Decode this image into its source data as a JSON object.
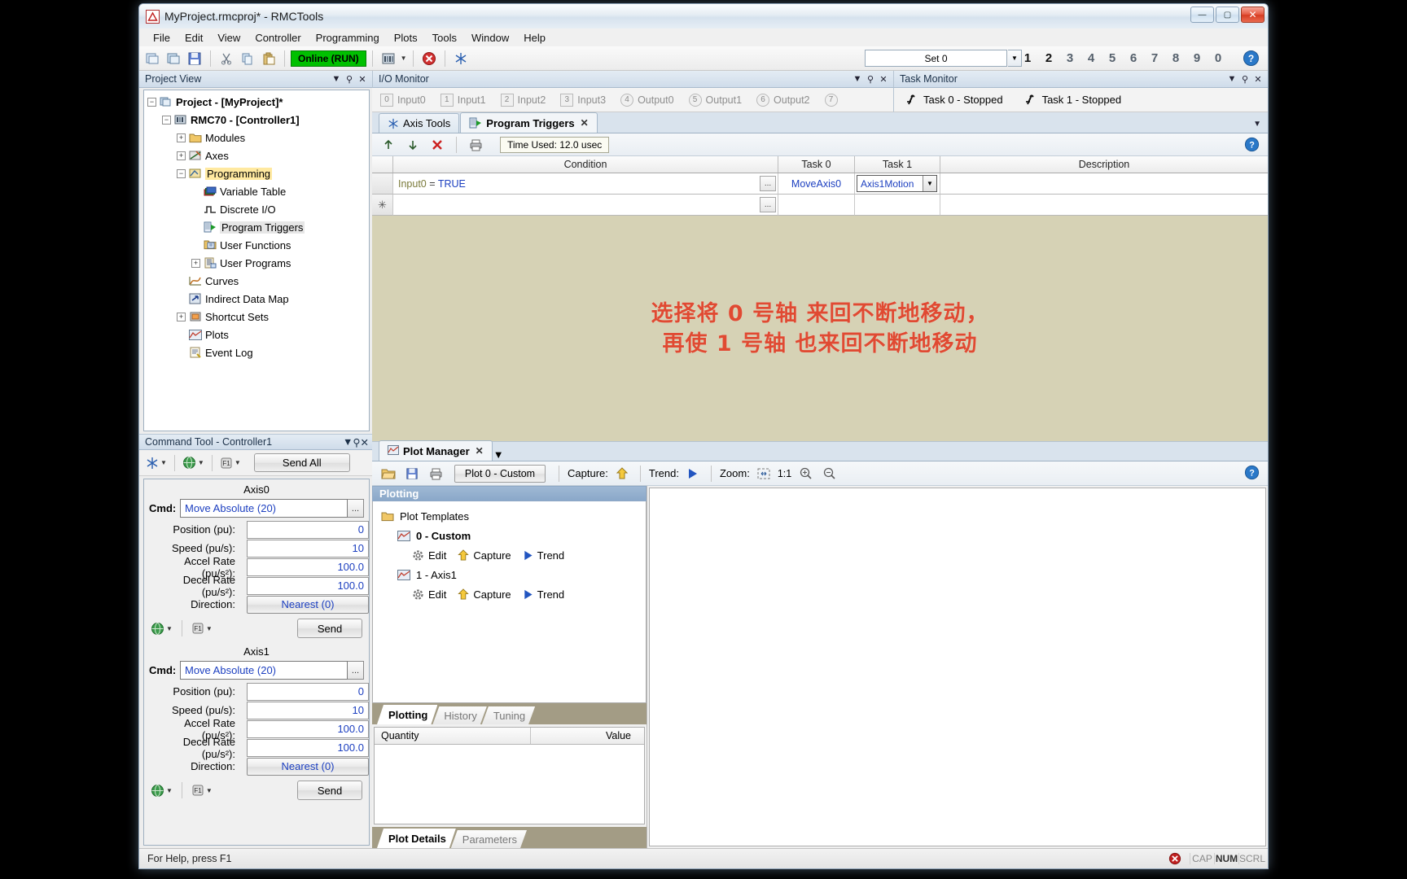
{
  "window": {
    "title": "MyProject.rmcproj* - RMCTools",
    "app_icon": "rmc-logo-icon",
    "minimize": "—",
    "maximize": "▢",
    "close": "✕"
  },
  "menubar": [
    "File",
    "Edit",
    "View",
    "Controller",
    "Programming",
    "Plots",
    "Tools",
    "Window",
    "Help"
  ],
  "toolbar": {
    "buttons": [
      "new-project-icon",
      "open-project-icon",
      "save-icon",
      "cut-icon",
      "copy-icon",
      "paste-icon"
    ],
    "online_status": "Online (RUN)",
    "controller_icon": "controller-icon",
    "stop-icon": "stop-error-icon",
    "axis-tools-icon": "axis-tools-icon",
    "set_value": "Set 0",
    "number_buttons": [
      "1",
      "2",
      "3",
      "4",
      "5",
      "6",
      "7",
      "8",
      "9",
      "0"
    ],
    "active_numbers": [
      "1",
      "2"
    ],
    "help_icon": "help-icon"
  },
  "project_view": {
    "title": "Project View",
    "collapse_icon": "▼",
    "pin_icon": "pin-icon",
    "close_icon": "✕",
    "tree": [
      {
        "label": "Project - [MyProject]*",
        "indent": 0,
        "expander": "−",
        "icon": "project-icon",
        "bold": true,
        "state": ""
      },
      {
        "label": "RMC70 - [Controller1]",
        "indent": 1,
        "expander": "−",
        "icon": "controller-icon",
        "bold": true,
        "state": ""
      },
      {
        "label": "Modules",
        "indent": 2,
        "expander": "+",
        "icon": "folder-icon",
        "bold": false,
        "state": ""
      },
      {
        "label": "Axes",
        "indent": 2,
        "expander": "+",
        "icon": "axes-icon",
        "bold": false,
        "state": ""
      },
      {
        "label": "Programming",
        "indent": 2,
        "expander": "−",
        "icon": "programming-icon",
        "bold": false,
        "state": "highlight"
      },
      {
        "label": "Variable Table",
        "indent": 3,
        "expander": "",
        "icon": "variable-table-icon",
        "bold": false,
        "state": ""
      },
      {
        "label": "Discrete I/O",
        "indent": 3,
        "expander": "",
        "icon": "discrete-io-icon",
        "bold": false,
        "state": ""
      },
      {
        "label": "Program Triggers",
        "indent": 3,
        "expander": "",
        "icon": "program-triggers-icon",
        "bold": false,
        "state": "selected"
      },
      {
        "label": "User Functions",
        "indent": 3,
        "expander": "",
        "icon": "user-functions-icon",
        "bold": false,
        "state": ""
      },
      {
        "label": "User Programs",
        "indent": 3,
        "expander": "+",
        "icon": "user-programs-icon",
        "bold": false,
        "state": ""
      },
      {
        "label": "Curves",
        "indent": 2,
        "expander": "",
        "icon": "curves-icon",
        "bold": false,
        "state": ""
      },
      {
        "label": "Indirect Data Map",
        "indent": 2,
        "expander": "",
        "icon": "indirect-data-map-icon",
        "bold": false,
        "state": ""
      },
      {
        "label": "Shortcut Sets",
        "indent": 2,
        "expander": "+",
        "icon": "shortcut-sets-icon",
        "bold": false,
        "state": ""
      },
      {
        "label": "Plots",
        "indent": 2,
        "expander": "",
        "icon": "plots-icon",
        "bold": false,
        "state": ""
      },
      {
        "label": "Event Log",
        "indent": 2,
        "expander": "",
        "icon": "event-log-icon",
        "bold": false,
        "state": ""
      }
    ]
  },
  "command_tool": {
    "title": "Command Tool - Controller1",
    "collapse_icon": "▼",
    "pin_icon": "pin-icon",
    "close_icon": "✕",
    "send_all_label": "Send All",
    "axes": [
      {
        "name": "Axis0",
        "cmd_label": "Cmd:",
        "cmd_value": "Move Absolute (20)",
        "ellipsis": "...",
        "fields": [
          {
            "label": "Position (pu):",
            "value": "0"
          },
          {
            "label": "Speed (pu/s):",
            "value": "10"
          },
          {
            "label": "Accel Rate (pu/s²):",
            "value": "100.0"
          },
          {
            "label": "Decel Rate (pu/s²):",
            "value": "100.0"
          },
          {
            "label": "Direction:",
            "value": "Nearest (0)"
          }
        ],
        "send_label": "Send"
      },
      {
        "name": "Axis1",
        "cmd_label": "Cmd:",
        "cmd_value": "Move Absolute (20)",
        "ellipsis": "...",
        "fields": [
          {
            "label": "Position (pu):",
            "value": "0"
          },
          {
            "label": "Speed (pu/s):",
            "value": "10"
          },
          {
            "label": "Accel Rate (pu/s²):",
            "value": "100.0"
          },
          {
            "label": "Decel Rate (pu/s²):",
            "value": "100.0"
          },
          {
            "label": "Direction:",
            "value": "Nearest (0)"
          }
        ],
        "send_label": "Send"
      }
    ]
  },
  "io_monitor": {
    "title": "I/O Monitor",
    "collapse_icon": "▼",
    "pin_icon": "pin-icon",
    "close_icon": "✕",
    "channels": [
      {
        "num": "0",
        "label": "Input0",
        "shape": "square"
      },
      {
        "num": "1",
        "label": "Input1",
        "shape": "square"
      },
      {
        "num": "2",
        "label": "Input2",
        "shape": "square"
      },
      {
        "num": "3",
        "label": "Input3",
        "shape": "square"
      },
      {
        "num": "4",
        "label": "Output0",
        "shape": "circle"
      },
      {
        "num": "5",
        "label": "Output1",
        "shape": "circle"
      },
      {
        "num": "6",
        "label": "Output2",
        "shape": "circle"
      },
      {
        "num": "7",
        "label": "",
        "shape": "circle"
      }
    ]
  },
  "task_monitor": {
    "title": "Task Monitor",
    "collapse_icon": "▼",
    "pin_icon": "pin-icon",
    "close_icon": "✕",
    "tasks": [
      {
        "icon": "task-icon",
        "label": "Task 0 - Stopped"
      },
      {
        "icon": "task-icon",
        "label": "Task 1 - Stopped"
      }
    ]
  },
  "doc_tabs": {
    "tabs": [
      {
        "label": "Axis Tools",
        "icon": "axis-tools-icon",
        "active": false,
        "closable": false
      },
      {
        "label": "Program Triggers",
        "icon": "program-triggers-icon",
        "active": true,
        "closable": true,
        "close": "✕"
      }
    ],
    "dropdown": "▼"
  },
  "program_triggers": {
    "toolbar": {
      "move_up_icon": "arrow-up-icon",
      "move_down_icon": "arrow-down-icon",
      "delete_icon": "delete-x-icon",
      "print_icon": "print-icon",
      "time_used": "Time Used: 12.0 usec",
      "help_icon": "help-icon"
    },
    "columns": [
      "",
      "Condition",
      "Task 0",
      "Task 1",
      "Description"
    ],
    "rows": [
      {
        "marker": "",
        "condition_var": "Input0",
        "condition_op": "=",
        "condition_val": "TRUE",
        "ellipsis": "...",
        "task0": "MoveAxis0",
        "task1": "Axis1Motion",
        "task1_dropdown": "▼",
        "description": ""
      },
      {
        "marker": "✳",
        "condition_var": "",
        "condition_op": "",
        "condition_val": "",
        "ellipsis": "...",
        "task0": "",
        "task1": "",
        "description": ""
      }
    ],
    "annotation": {
      "line1": "选择将 0 号轴 来回不断地移动，",
      "line2": "再使 1 号轴 也来回不断地移动",
      "color": "#e04a32"
    }
  },
  "plot_manager": {
    "tab_label": "Plot Manager",
    "tab_icon": "plot-manager-icon",
    "tab_close": "✕",
    "dropdown": "▼",
    "toolbar": {
      "open_icon": "open-folder-icon",
      "save_icon": "save-icon",
      "print_icon": "print-icon",
      "plot_name": "Plot 0 - Custom",
      "capture_label": "Capture:",
      "capture_icon": "capture-up-arrow-icon",
      "trend_label": "Trend:",
      "trend_icon": "trend-play-icon",
      "zoom_label": "Zoom:",
      "zoom_fit_icon": "zoom-fit-icon",
      "zoom_1to1": "1:1",
      "zoom_in_icon": "zoom-in-icon",
      "zoom_out_icon": "zoom-out-icon",
      "help_icon": "help-icon"
    },
    "panel_title": "Plotting",
    "tree": [
      {
        "label": "Plot Templates",
        "icon": "folder-icon",
        "indent": 0,
        "bold": false,
        "actions": []
      },
      {
        "label": "0 - Custom",
        "icon": "plot-icon",
        "indent": 1,
        "bold": true,
        "actions": []
      },
      {
        "label": "",
        "icon": "",
        "indent": 2,
        "bold": false,
        "actions": [
          {
            "label": "Edit",
            "icon": "gear-icon"
          },
          {
            "label": "Capture",
            "icon": "capture-up-arrow-icon"
          },
          {
            "label": "Trend",
            "icon": "trend-play-icon"
          }
        ]
      },
      {
        "label": "1 - Axis1",
        "icon": "plot-icon",
        "indent": 1,
        "bold": false,
        "actions": []
      },
      {
        "label": "",
        "icon": "",
        "indent": 2,
        "bold": false,
        "actions": [
          {
            "label": "Edit",
            "icon": "gear-icon"
          },
          {
            "label": "Capture",
            "icon": "capture-up-arrow-icon"
          },
          {
            "label": "Trend",
            "icon": "trend-play-icon"
          }
        ]
      }
    ],
    "lower_tabs": [
      {
        "label": "Plotting",
        "active": true
      },
      {
        "label": "History",
        "active": false
      },
      {
        "label": "Tuning",
        "active": false
      }
    ],
    "quantity_table": {
      "columns": [
        "Quantity",
        "Value"
      ],
      "rows": []
    },
    "detail_tabs": [
      {
        "label": "Plot Details",
        "active": true
      },
      {
        "label": "Parameters",
        "active": false
      }
    ]
  },
  "status_bar": {
    "message": "For Help, press F1",
    "error_icon": "error-icon",
    "keys": [
      "CAP",
      "NUM",
      "SCRL"
    ]
  }
}
